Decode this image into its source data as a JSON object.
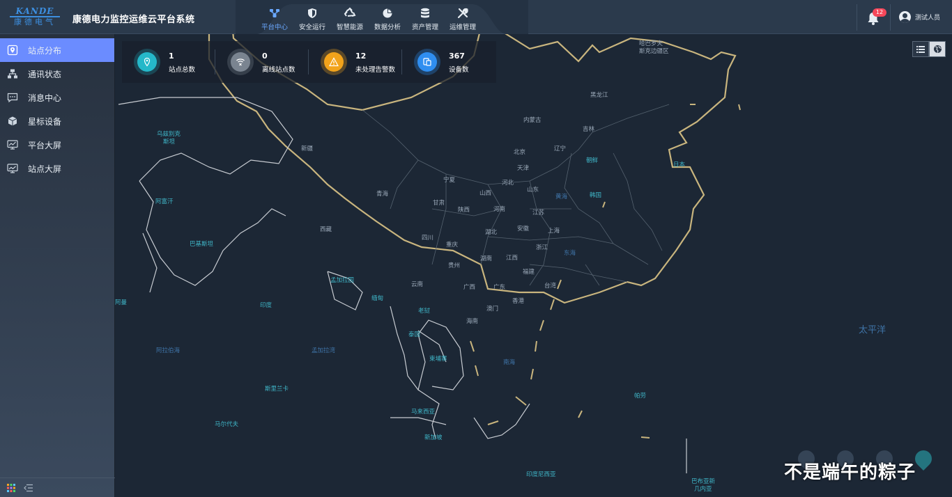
{
  "header": {
    "logo_en": "KANDE",
    "logo_cn": "康德电气",
    "title": "康德电力监控运维云平台系统",
    "nav": [
      {
        "label": "平台中心",
        "icon": "platform-icon",
        "active": true
      },
      {
        "label": "安全运行",
        "icon": "shield-icon",
        "active": false
      },
      {
        "label": "智慧能源",
        "icon": "recycle-icon",
        "active": false
      },
      {
        "label": "数据分析",
        "icon": "pie-chart-icon",
        "active": false
      },
      {
        "label": "资产管理",
        "icon": "database-icon",
        "active": false
      },
      {
        "label": "运维管理",
        "icon": "tools-icon",
        "active": false
      }
    ],
    "notifications_count": "12",
    "user_name": "测试人员"
  },
  "sidebar": {
    "items": [
      {
        "label": "站点分布",
        "icon": "location-icon",
        "active": true
      },
      {
        "label": "通讯状态",
        "icon": "network-icon",
        "active": false
      },
      {
        "label": "消息中心",
        "icon": "message-icon",
        "active": false
      },
      {
        "label": "星标设备",
        "icon": "cube-icon",
        "active": false
      },
      {
        "label": "平台大屏",
        "icon": "monitor-chart-icon",
        "active": false
      },
      {
        "label": "站点大屏",
        "icon": "monitor-icon",
        "active": false
      }
    ]
  },
  "stats": [
    {
      "value": "1",
      "label": "站点总数",
      "icon": "location-icon",
      "color": "#25b8c9"
    },
    {
      "value": "0",
      "label": "离线站点数",
      "icon": "wifi-off-icon",
      "color": "#7a8490"
    },
    {
      "value": "12",
      "label": "未处理告警数",
      "icon": "warning-icon",
      "color": "#f2a31b"
    },
    {
      "value": "367",
      "label": "设备数",
      "icon": "devices-icon",
      "color": "#2f8ef0"
    }
  ],
  "map": {
    "labels": [
      {
        "text": "哈巴罗夫",
        "type": "gray"
      },
      {
        "text": "斯克边疆区",
        "type": "gray"
      },
      {
        "text": "黑龙江",
        "type": "gray"
      },
      {
        "text": "内蒙古",
        "type": "gray"
      },
      {
        "text": "吉林",
        "type": "gray"
      },
      {
        "text": "辽宁",
        "type": "gray"
      },
      {
        "text": "北京",
        "type": "gray"
      },
      {
        "text": "天津",
        "type": "gray"
      },
      {
        "text": "朝鲜",
        "type": "blue"
      },
      {
        "text": "日本",
        "type": "blue"
      },
      {
        "text": "韩国",
        "type": "blue"
      },
      {
        "text": "乌兹别克",
        "type": "blue"
      },
      {
        "text": "斯坦",
        "type": "blue"
      },
      {
        "text": "新疆",
        "type": "gray"
      },
      {
        "text": "青海",
        "type": "gray"
      },
      {
        "text": "宁夏",
        "type": "gray"
      },
      {
        "text": "甘肃",
        "type": "gray"
      },
      {
        "text": "山西",
        "type": "gray"
      },
      {
        "text": "河北",
        "type": "gray"
      },
      {
        "text": "山东",
        "type": "gray"
      },
      {
        "text": "黄海",
        "type": "sea"
      },
      {
        "text": "陕西",
        "type": "gray"
      },
      {
        "text": "河南",
        "type": "gray"
      },
      {
        "text": "江苏",
        "type": "gray"
      },
      {
        "text": "阿富汗",
        "type": "blue"
      },
      {
        "text": "西藏",
        "type": "gray"
      },
      {
        "text": "四川",
        "type": "gray"
      },
      {
        "text": "湖北",
        "type": "gray"
      },
      {
        "text": "安徽",
        "type": "gray"
      },
      {
        "text": "上海",
        "type": "gray"
      },
      {
        "text": "巴基斯坦",
        "type": "blue"
      },
      {
        "text": "重庆",
        "type": "gray"
      },
      {
        "text": "浙江",
        "type": "gray"
      },
      {
        "text": "东海",
        "type": "sea"
      },
      {
        "text": "贵州",
        "type": "gray"
      },
      {
        "text": "湖南",
        "type": "gray"
      },
      {
        "text": "江西",
        "type": "gray"
      },
      {
        "text": "福建",
        "type": "gray"
      },
      {
        "text": "孟加拉国",
        "type": "blue"
      },
      {
        "text": "云南",
        "type": "gray"
      },
      {
        "text": "广西",
        "type": "gray"
      },
      {
        "text": "广东",
        "type": "gray"
      },
      {
        "text": "台湾",
        "type": "gray"
      },
      {
        "text": "阿曼",
        "type": "blue"
      },
      {
        "text": "印度",
        "type": "blue"
      },
      {
        "text": "缅甸",
        "type": "blue"
      },
      {
        "text": "老挝",
        "type": "blue"
      },
      {
        "text": "澳门",
        "type": "gray"
      },
      {
        "text": "香港",
        "type": "gray"
      },
      {
        "text": "海南",
        "type": "gray"
      },
      {
        "text": "泰国",
        "type": "blue"
      },
      {
        "text": "太平洋",
        "type": "ocean"
      },
      {
        "text": "阿拉伯海",
        "type": "sea"
      },
      {
        "text": "孟加拉湾",
        "type": "sea"
      },
      {
        "text": "柬埔寨",
        "type": "blue"
      },
      {
        "text": "南海",
        "type": "sea"
      },
      {
        "text": "斯里兰卡",
        "type": "blue"
      },
      {
        "text": "帕劳",
        "type": "blue"
      },
      {
        "text": "马来西亚",
        "type": "blue"
      },
      {
        "text": "马尔代夫",
        "type": "blue"
      },
      {
        "text": "新加坡",
        "type": "blue"
      },
      {
        "text": "印度尼西亚",
        "type": "blue"
      },
      {
        "text": "巴布亚新",
        "type": "blue"
      },
      {
        "text": "几内亚",
        "type": "blue"
      }
    ]
  },
  "watermark": "不是端午的粽子"
}
